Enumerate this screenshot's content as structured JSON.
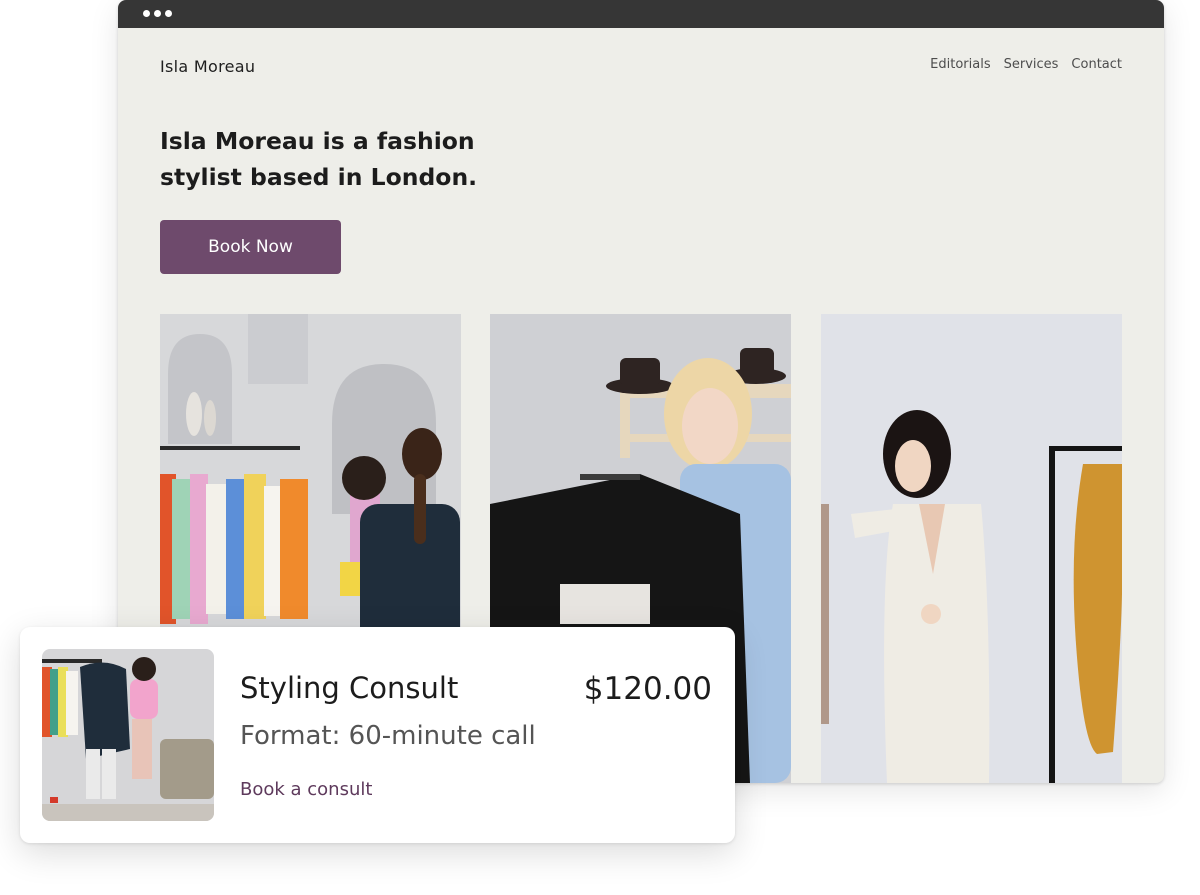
{
  "site": {
    "brand": "Isla Moreau",
    "nav": [
      "Editorials",
      "Services",
      "Contact"
    ],
    "headline": "Isla Moreau is a fashion stylist based in London.",
    "cta_label": "Book Now"
  },
  "gallery": [
    {
      "subject": "two women browsing a clothing rail"
    },
    {
      "subject": "woman holding a black blazer"
    },
    {
      "subject": "woman in white suit near dress rack"
    }
  ],
  "product_card": {
    "title": "Styling Consult",
    "price": "$120.00",
    "format": "Format: 60-minute call",
    "link_label": "Book a consult"
  },
  "colors": {
    "accent": "#6e4a6c",
    "page_background": "#eeeee9",
    "titlebar": "#363636"
  }
}
